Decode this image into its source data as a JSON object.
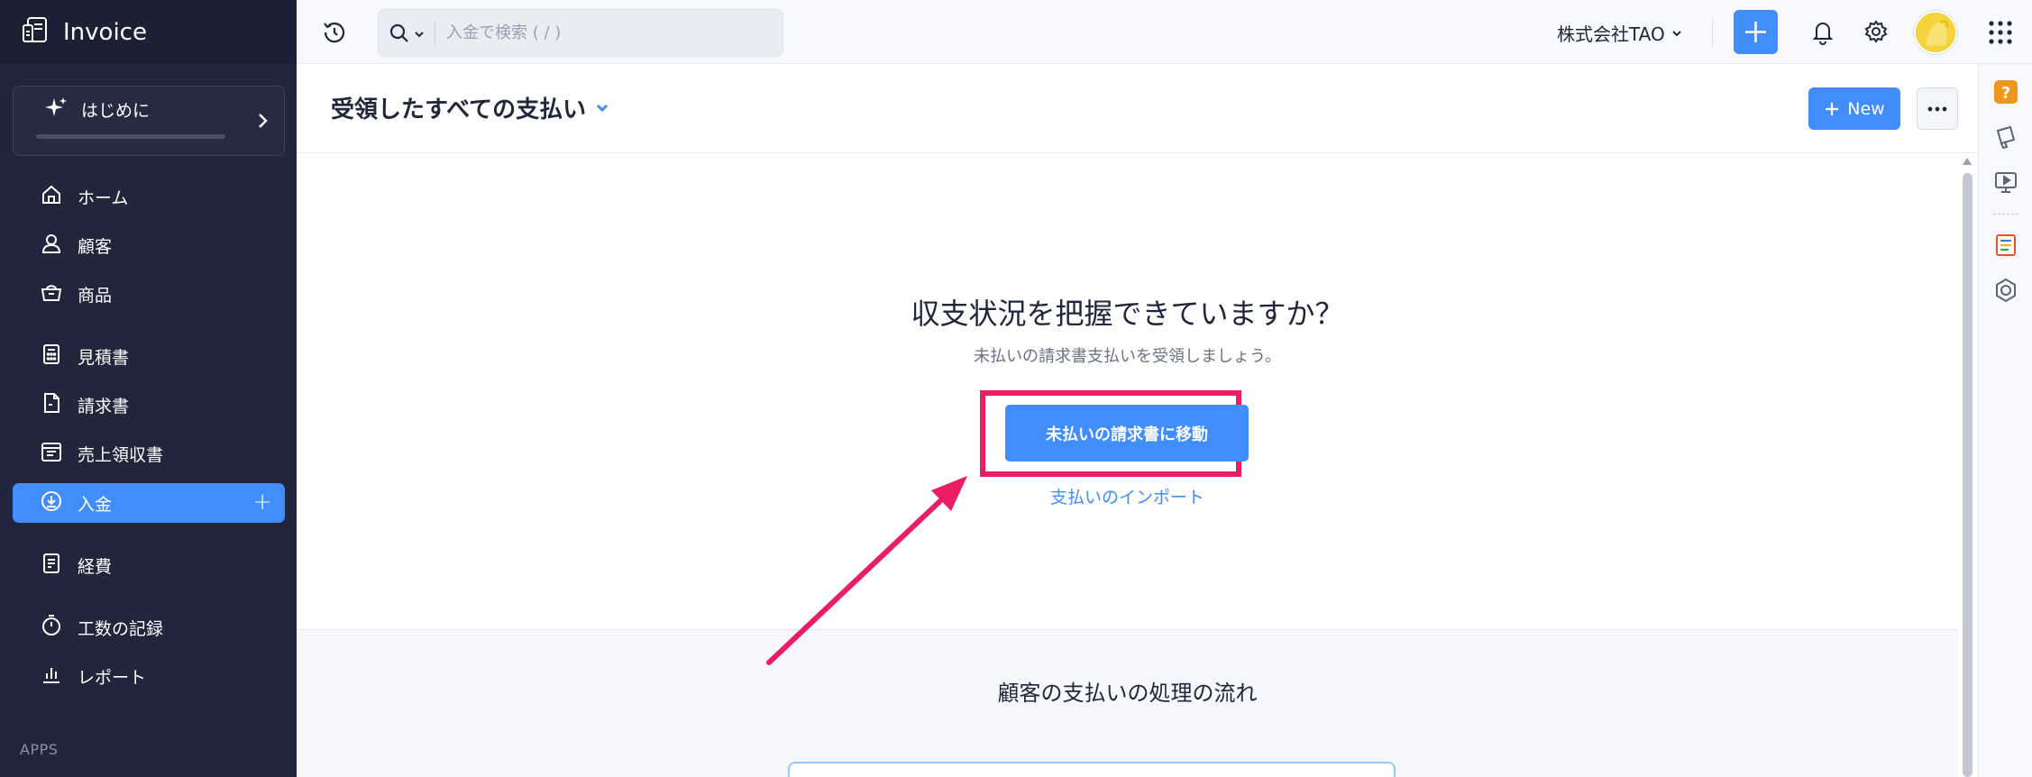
{
  "brand": {
    "title": "Invoice"
  },
  "sidebar": {
    "getting_started": "はじめに",
    "items": [
      {
        "label": "ホーム",
        "icon": "home-icon"
      },
      {
        "label": "顧客",
        "icon": "user-icon"
      },
      {
        "label": "商品",
        "icon": "basket-icon"
      },
      {
        "label": "見積書",
        "icon": "calculator-icon"
      },
      {
        "label": "請求書",
        "icon": "document-icon"
      },
      {
        "label": "売上領収書",
        "icon": "receipt-icon"
      },
      {
        "label": "入金",
        "icon": "download-icon",
        "active": true,
        "action": "+"
      },
      {
        "label": "経費",
        "icon": "expense-icon"
      },
      {
        "label": "工数の記録",
        "icon": "timer-icon"
      },
      {
        "label": "レポート",
        "icon": "bar-chart-icon"
      }
    ],
    "apps_label": "APPS"
  },
  "topbar": {
    "search_placeholder": "入金で検索 ( / )",
    "organization": "株式会社TAO"
  },
  "page": {
    "title": "受領したすべての支払い",
    "new_label": "New"
  },
  "empty_state": {
    "heading": "収支状況を把握できていますか？",
    "subtext": "未払いの請求書支払いを受領しましょう。",
    "cta_label": "未払いの請求書に移動",
    "import_label": "支払いのインポート"
  },
  "flow": {
    "title": "顧客の支払いの処理の流れ"
  },
  "colors": {
    "sidebar_bg": "#21263c",
    "accent": "#408dfb",
    "highlight": "#ec1c65"
  }
}
